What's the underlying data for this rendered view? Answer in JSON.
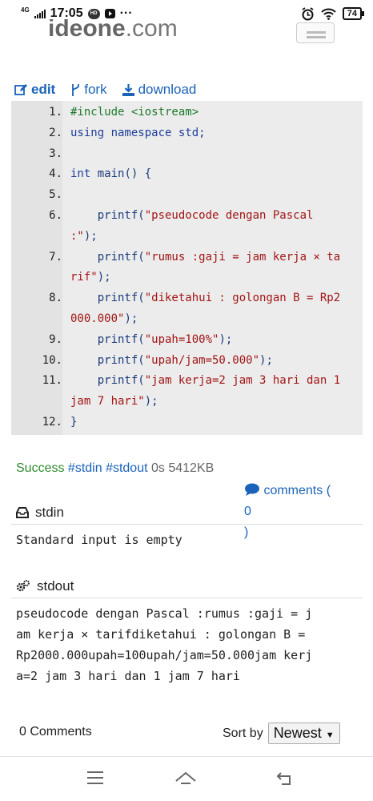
{
  "status_bar": {
    "network": "4G",
    "time": "17:05",
    "hd_badge": "HD",
    "more": "···",
    "battery": "74",
    "icons": [
      "signal-icon",
      "hd-icon",
      "youtube-icon",
      "alarm-icon",
      "wifi-icon",
      "battery-icon"
    ]
  },
  "site": {
    "logo_main": "ideone",
    "logo_suffix": ".com"
  },
  "toolbar": {
    "edit": "edit",
    "fork": "fork",
    "download": "download",
    "color": "#1a63b8"
  },
  "code": {
    "lines": [
      {
        "num": "1.",
        "parts": [
          {
            "t": "#include <iostream>",
            "c": "pp"
          }
        ]
      },
      {
        "num": "2.",
        "parts": [
          {
            "t": "using namespace std",
            "c": "kw"
          },
          {
            "t": ";",
            "c": "plain"
          }
        ]
      },
      {
        "num": "3.",
        "parts": []
      },
      {
        "num": "4.",
        "parts": [
          {
            "t": "int",
            "c": "kw"
          },
          {
            "t": " main() {",
            "c": "plain"
          }
        ]
      },
      {
        "num": "5.",
        "parts": []
      },
      {
        "num": "6.",
        "parts": [
          {
            "t": "    printf(",
            "c": "plain"
          },
          {
            "t": "\"pseudocode dengan Pascal",
            "c": "str"
          }
        ],
        "wrap": [
          {
            "t": ":\"",
            "c": "str"
          },
          {
            "t": ");",
            "c": "plain"
          }
        ]
      },
      {
        "num": "7.",
        "parts": [
          {
            "t": "    printf(",
            "c": "plain"
          },
          {
            "t": "\"rumus :gaji = jam kerja × ta",
            "c": "str"
          }
        ],
        "wrap": [
          {
            "t": "rif\"",
            "c": "str"
          },
          {
            "t": ");",
            "c": "plain"
          }
        ]
      },
      {
        "num": "8.",
        "parts": [
          {
            "t": "    printf(",
            "c": "plain"
          },
          {
            "t": "\"diketahui : golongan B = Rp2",
            "c": "str"
          }
        ],
        "wrap": [
          {
            "t": "000.000\"",
            "c": "str"
          },
          {
            "t": ");",
            "c": "plain"
          }
        ]
      },
      {
        "num": "9.",
        "parts": [
          {
            "t": "    printf(",
            "c": "plain"
          },
          {
            "t": "\"upah=100%\"",
            "c": "str"
          },
          {
            "t": ");",
            "c": "plain"
          }
        ]
      },
      {
        "num": "10.",
        "parts": [
          {
            "t": "    printf(",
            "c": "plain"
          },
          {
            "t": "\"upah/jam=50.000\"",
            "c": "str"
          },
          {
            "t": ");",
            "c": "plain"
          }
        ]
      },
      {
        "num": "11.",
        "parts": [
          {
            "t": "    printf(",
            "c": "plain"
          },
          {
            "t": "\"jam kerja=2 jam 3 hari dan 1",
            "c": "str"
          }
        ],
        "wrap": [
          {
            "t": "jam 7 hari\"",
            "c": "str"
          },
          {
            "t": ");",
            "c": "plain"
          }
        ]
      },
      {
        "num": "12.",
        "parts": [
          {
            "t": "}",
            "c": "plain"
          }
        ]
      }
    ]
  },
  "result": {
    "status": "Success",
    "tags": "#stdin #stdout",
    "meta": "0s 5412KB"
  },
  "comments_link": {
    "label": "comments (",
    "count": "0",
    "close": ")"
  },
  "stdin": {
    "title": "stdin",
    "content": "Standard input is empty"
  },
  "stdout": {
    "title": "stdout",
    "lines": [
      "pseudocode dengan Pascal :rumus :gaji = j",
      "am kerja × tarifdiketahui : golongan B =",
      "Rp2000.000upah=100upah/jam=50.000jam kerj",
      "a=2 jam 3 hari dan 1 jam 7 hari"
    ]
  },
  "comments_bar": {
    "count_label": "0 Comments",
    "sort_label": "Sort by",
    "sort_value": "Newest"
  },
  "nav": [
    "menu-icon",
    "home-icon",
    "back-icon"
  ]
}
